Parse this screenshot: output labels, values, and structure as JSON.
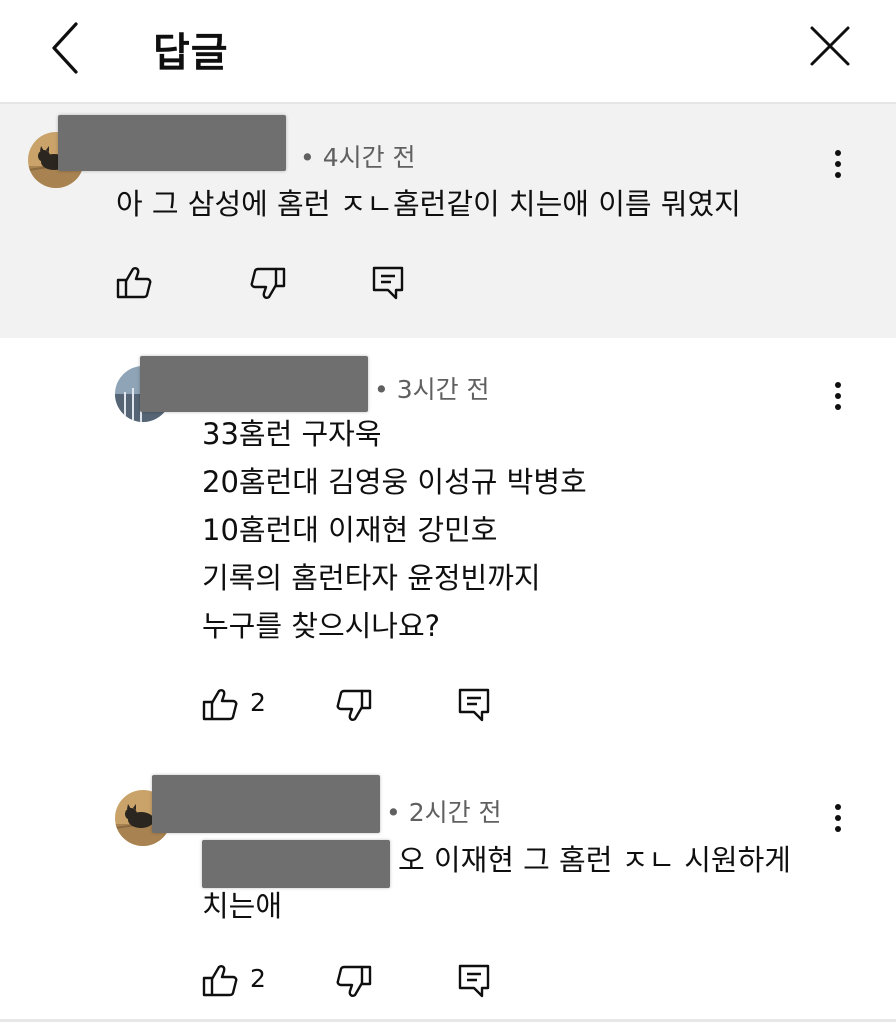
{
  "header": {
    "title": "답글",
    "back_icon": "chevron-left-icon",
    "close_icon": "close-icon"
  },
  "parent_comment": {
    "meta": "• 4시간 전",
    "text": "아 그 삼성에 홈런 ㅈㄴ홈런같이 치는애 이름 뭐였지",
    "like_count": ""
  },
  "replies": [
    {
      "meta": "• 3시간 전",
      "lines": [
        "33홈런 구자욱",
        "20홈런대 김영웅 이성규 박병호",
        "10홈런대 이재현 강민호",
        "기록의 홈런타자 윤정빈까지",
        "누구를 찾으시나요?"
      ],
      "like_count": "2"
    },
    {
      "meta": "• 2시간 전",
      "line1": "오 이재현 그 홈런 ㅈㄴ 시원하게",
      "line2": "치는애",
      "like_count": "2"
    }
  ],
  "colors": {
    "parent_bg": "#f2f2f2",
    "redaction": "#6f6f6f",
    "meta_text": "#606060"
  }
}
